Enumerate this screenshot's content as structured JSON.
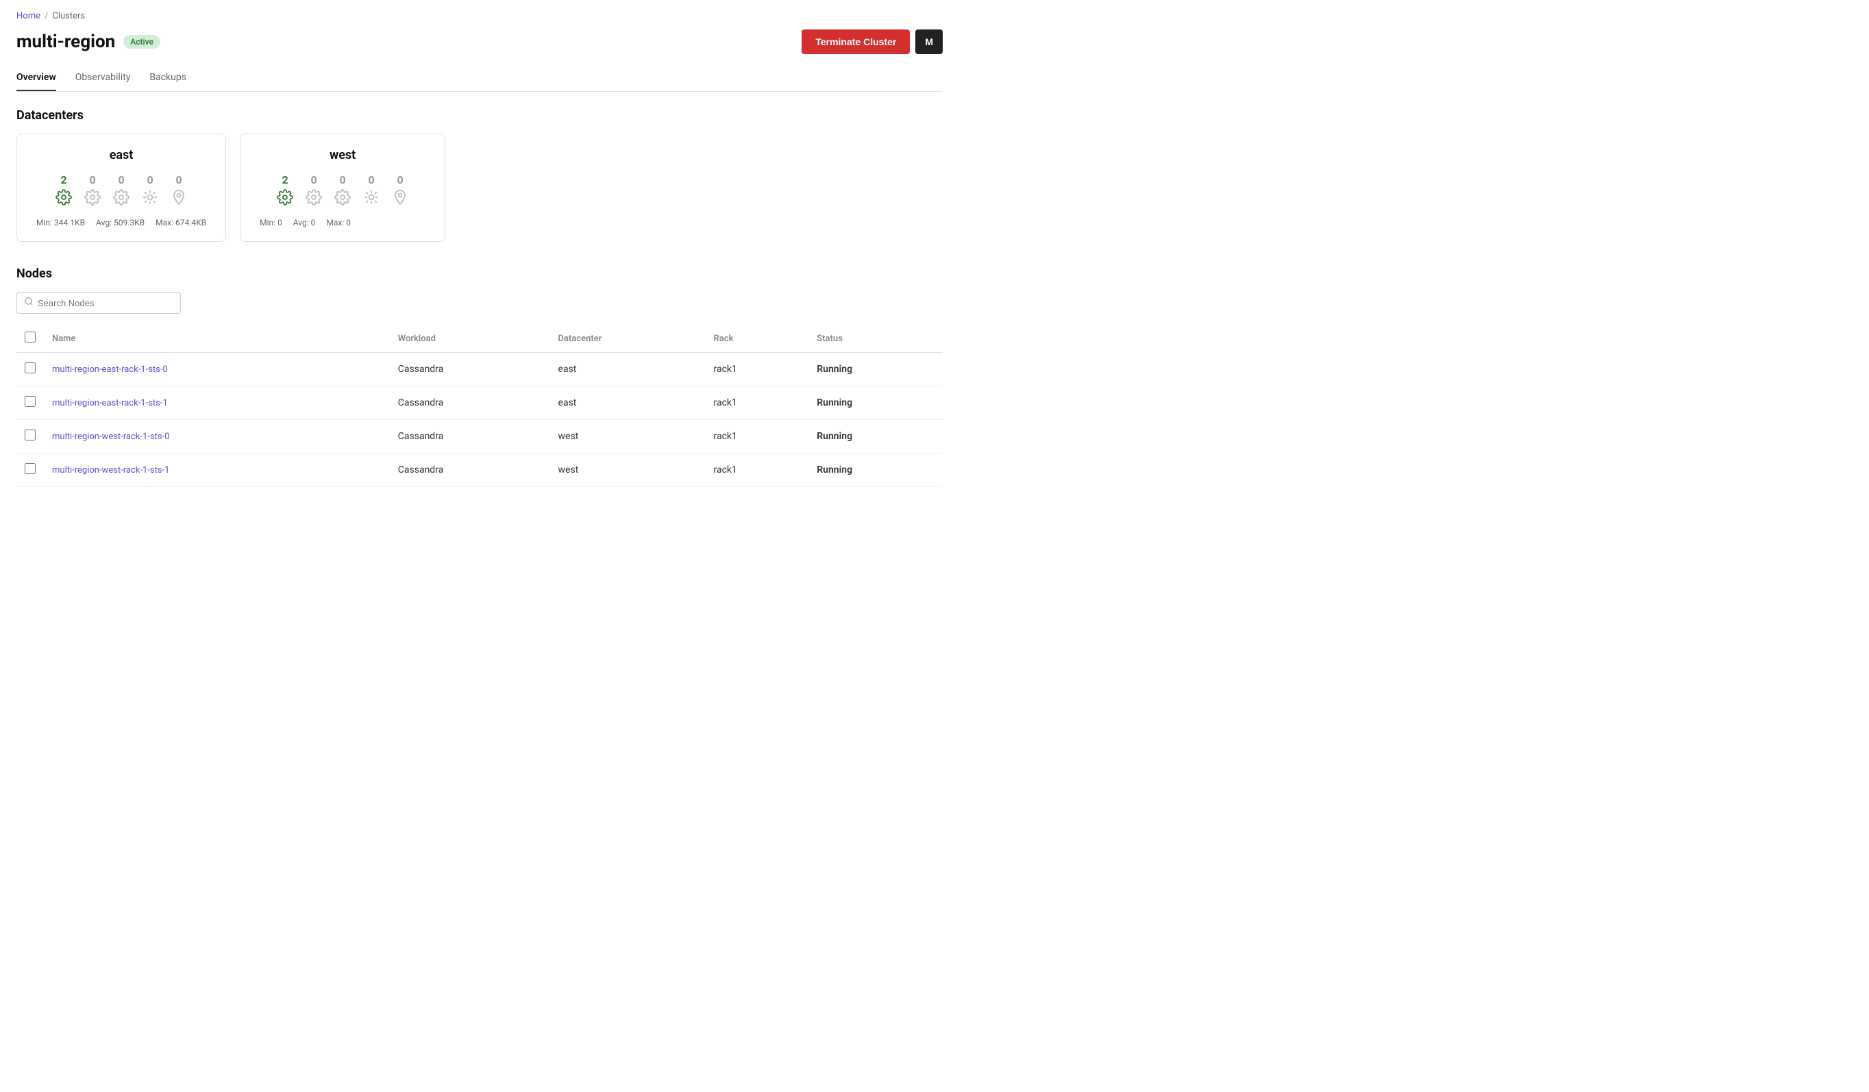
{
  "breadcrumb": {
    "home": "Home",
    "separator": "/",
    "clusters": "Clusters"
  },
  "header": {
    "title": "multi-region",
    "status": "Active",
    "terminate_label": "Terminate Cluster",
    "avatar_label": "M"
  },
  "tabs": [
    {
      "id": "overview",
      "label": "Overview",
      "active": true
    },
    {
      "id": "observability",
      "label": "Observability",
      "active": false
    },
    {
      "id": "backups",
      "label": "Backups",
      "active": false
    }
  ],
  "datacenters": {
    "section_title": "Datacenters",
    "items": [
      {
        "name": "east",
        "nodes": [
          {
            "count": "2",
            "active": true
          },
          {
            "count": "0",
            "active": false
          },
          {
            "count": "0",
            "active": false
          },
          {
            "count": "0",
            "active": false
          },
          {
            "count": "0",
            "active": false
          }
        ],
        "stats": {
          "min": "Min: 344.1KB",
          "avg": "Avg: 509.3KB",
          "max": "Max: 674.4KB"
        }
      },
      {
        "name": "west",
        "nodes": [
          {
            "count": "2",
            "active": true
          },
          {
            "count": "0",
            "active": false
          },
          {
            "count": "0",
            "active": false
          },
          {
            "count": "0",
            "active": false
          },
          {
            "count": "0",
            "active": false
          }
        ],
        "stats": {
          "min": "Min: 0",
          "avg": "Avg: 0",
          "max": "Max: 0"
        }
      }
    ]
  },
  "nodes": {
    "section_title": "Nodes",
    "search_placeholder": "Search Nodes",
    "columns": [
      "Name",
      "Workload",
      "Datacenter",
      "Rack",
      "Status"
    ],
    "rows": [
      {
        "name": "multi-region-east-rack-1-sts-0",
        "workload": "Cassandra",
        "datacenter": "east",
        "rack": "rack1",
        "status": "Running"
      },
      {
        "name": "multi-region-east-rack-1-sts-1",
        "workload": "Cassandra",
        "datacenter": "east",
        "rack": "rack1",
        "status": "Running"
      },
      {
        "name": "multi-region-west-rack-1-sts-0",
        "workload": "Cassandra",
        "datacenter": "west",
        "rack": "rack1",
        "status": "Running"
      },
      {
        "name": "multi-region-west-rack-1-sts-1",
        "workload": "Cassandra",
        "datacenter": "west",
        "rack": "rack1",
        "status": "Running"
      }
    ]
  }
}
